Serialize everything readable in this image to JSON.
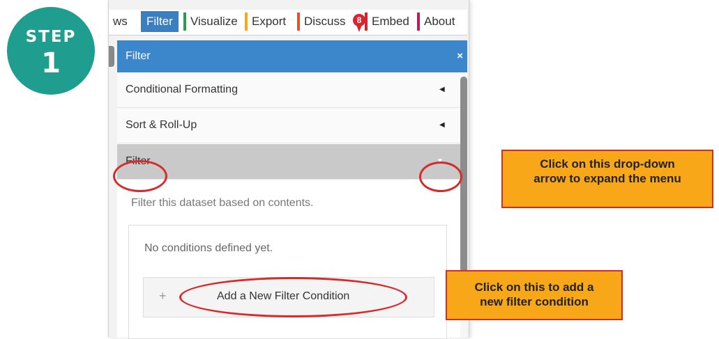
{
  "step": {
    "word": "STEP",
    "number": "1"
  },
  "tabs": [
    {
      "label": "ws"
    },
    {
      "label": "Filter"
    },
    {
      "label": "Visualize",
      "color": "#2e9a4b"
    },
    {
      "label": "Export",
      "color": "#f7a718"
    },
    {
      "label": "Discuss",
      "color": "#e8502a"
    },
    {
      "label": "Embed",
      "color": "#d9232d"
    },
    {
      "label": "About",
      "color": "#c2185b"
    }
  ],
  "discuss_badge": "8",
  "panel": {
    "title": "Filter",
    "close": "×",
    "sections": [
      {
        "label": "Conditional Formatting",
        "arrow": "◀"
      },
      {
        "label": "Sort & Roll-Up",
        "arrow": "◀"
      },
      {
        "label": "Filter",
        "arrow": "▼"
      }
    ],
    "description": "Filter this dataset based on contents.",
    "no_conditions": "No conditions defined yet.",
    "add_button": {
      "icon": "+",
      "label": "Add a New Filter Condition"
    }
  },
  "callouts": {
    "dropdown": [
      "Click on this drop-down",
      "arrow to expand the menu"
    ],
    "add": [
      "Click on this to add a",
      "new filter condition"
    ]
  },
  "colors": {
    "accent": "#3c86cc",
    "step": "#1f9e8f",
    "callout": "#f7a718",
    "ring": "#d62b2b"
  }
}
